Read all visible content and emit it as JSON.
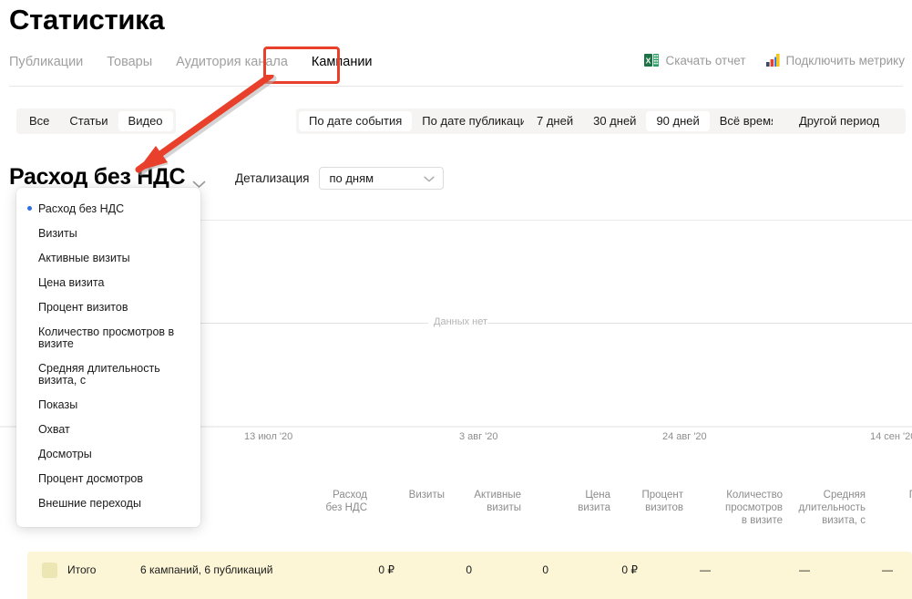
{
  "header": {
    "title": "Статистика"
  },
  "tabs": [
    {
      "label": "Публикации",
      "active": false
    },
    {
      "label": "Товары",
      "active": false
    },
    {
      "label": "Аудитория канала",
      "active": false
    },
    {
      "label": "Кампании",
      "active": true
    }
  ],
  "top_actions": [
    {
      "label": "Скачать отчет",
      "icon": "excel-icon"
    },
    {
      "label": "Подключить метрику",
      "icon": "metrica-icon"
    }
  ],
  "filters": {
    "content_type": {
      "options": [
        "Все",
        "Статьи",
        "Видео"
      ],
      "selected": "Видео"
    },
    "date_basis": {
      "options": [
        "По дате события",
        "По дате публикации"
      ],
      "selected": "По дате события"
    },
    "range": {
      "options": [
        "7 дней",
        "30 дней",
        "90 дней",
        "Всё время"
      ],
      "selected": "90 дней"
    },
    "custom_period": {
      "label": "Другой период"
    }
  },
  "metric_selector": {
    "current": "Расход без НДС",
    "chevron": "chevron-down-icon",
    "options": [
      "Расход без НДС",
      "Визиты",
      "Активные визиты",
      "Цена визита",
      "Процент визитов",
      "Количество просмотров в визите",
      "Средняя длительность визита, с",
      "Показы",
      "Охват",
      "Досмотры",
      "Процент досмотров",
      "Внешние переходы"
    ],
    "selected_index": 0,
    "selected_dot_color": "#2f6fe4"
  },
  "detalization": {
    "label": "Детализация",
    "value": "по дням",
    "chevron": "chevron-down-icon"
  },
  "chart_data": {
    "type": "line",
    "title": "Расход без НДС",
    "empty_message": "Данных нет",
    "series": [
      {
        "name": "Расход без НДС",
        "values": []
      }
    ],
    "x": [],
    "xlabel": "",
    "ylabel": "",
    "x_tick_labels": [
      "13 июл '20",
      "3 авг '20",
      "24 авг '20",
      "14 сен '20"
    ],
    "y_tick_labels": [],
    "grid": true,
    "legend": "none"
  },
  "table": {
    "columns": [
      "Расход\nбез НДС",
      "Визиты",
      "Активные\nвизиты",
      "Цена\nвизита",
      "Процент\nвизитов",
      "Количество\nпросмотров\nв визите",
      "Средняя\nдлительность\nвизита, с",
      "П"
    ],
    "totals_row": {
      "label": "Итого",
      "subtitle": "6 кампаний, 6 публикаций",
      "values": [
        "0 ₽",
        "0",
        "0",
        "0 ₽",
        "—",
        "—",
        "—",
        ""
      ]
    }
  },
  "annotation": {
    "type": "arrow",
    "color": "#e8402a",
    "points_to": "Расход без НДС",
    "from": "Кампании"
  }
}
